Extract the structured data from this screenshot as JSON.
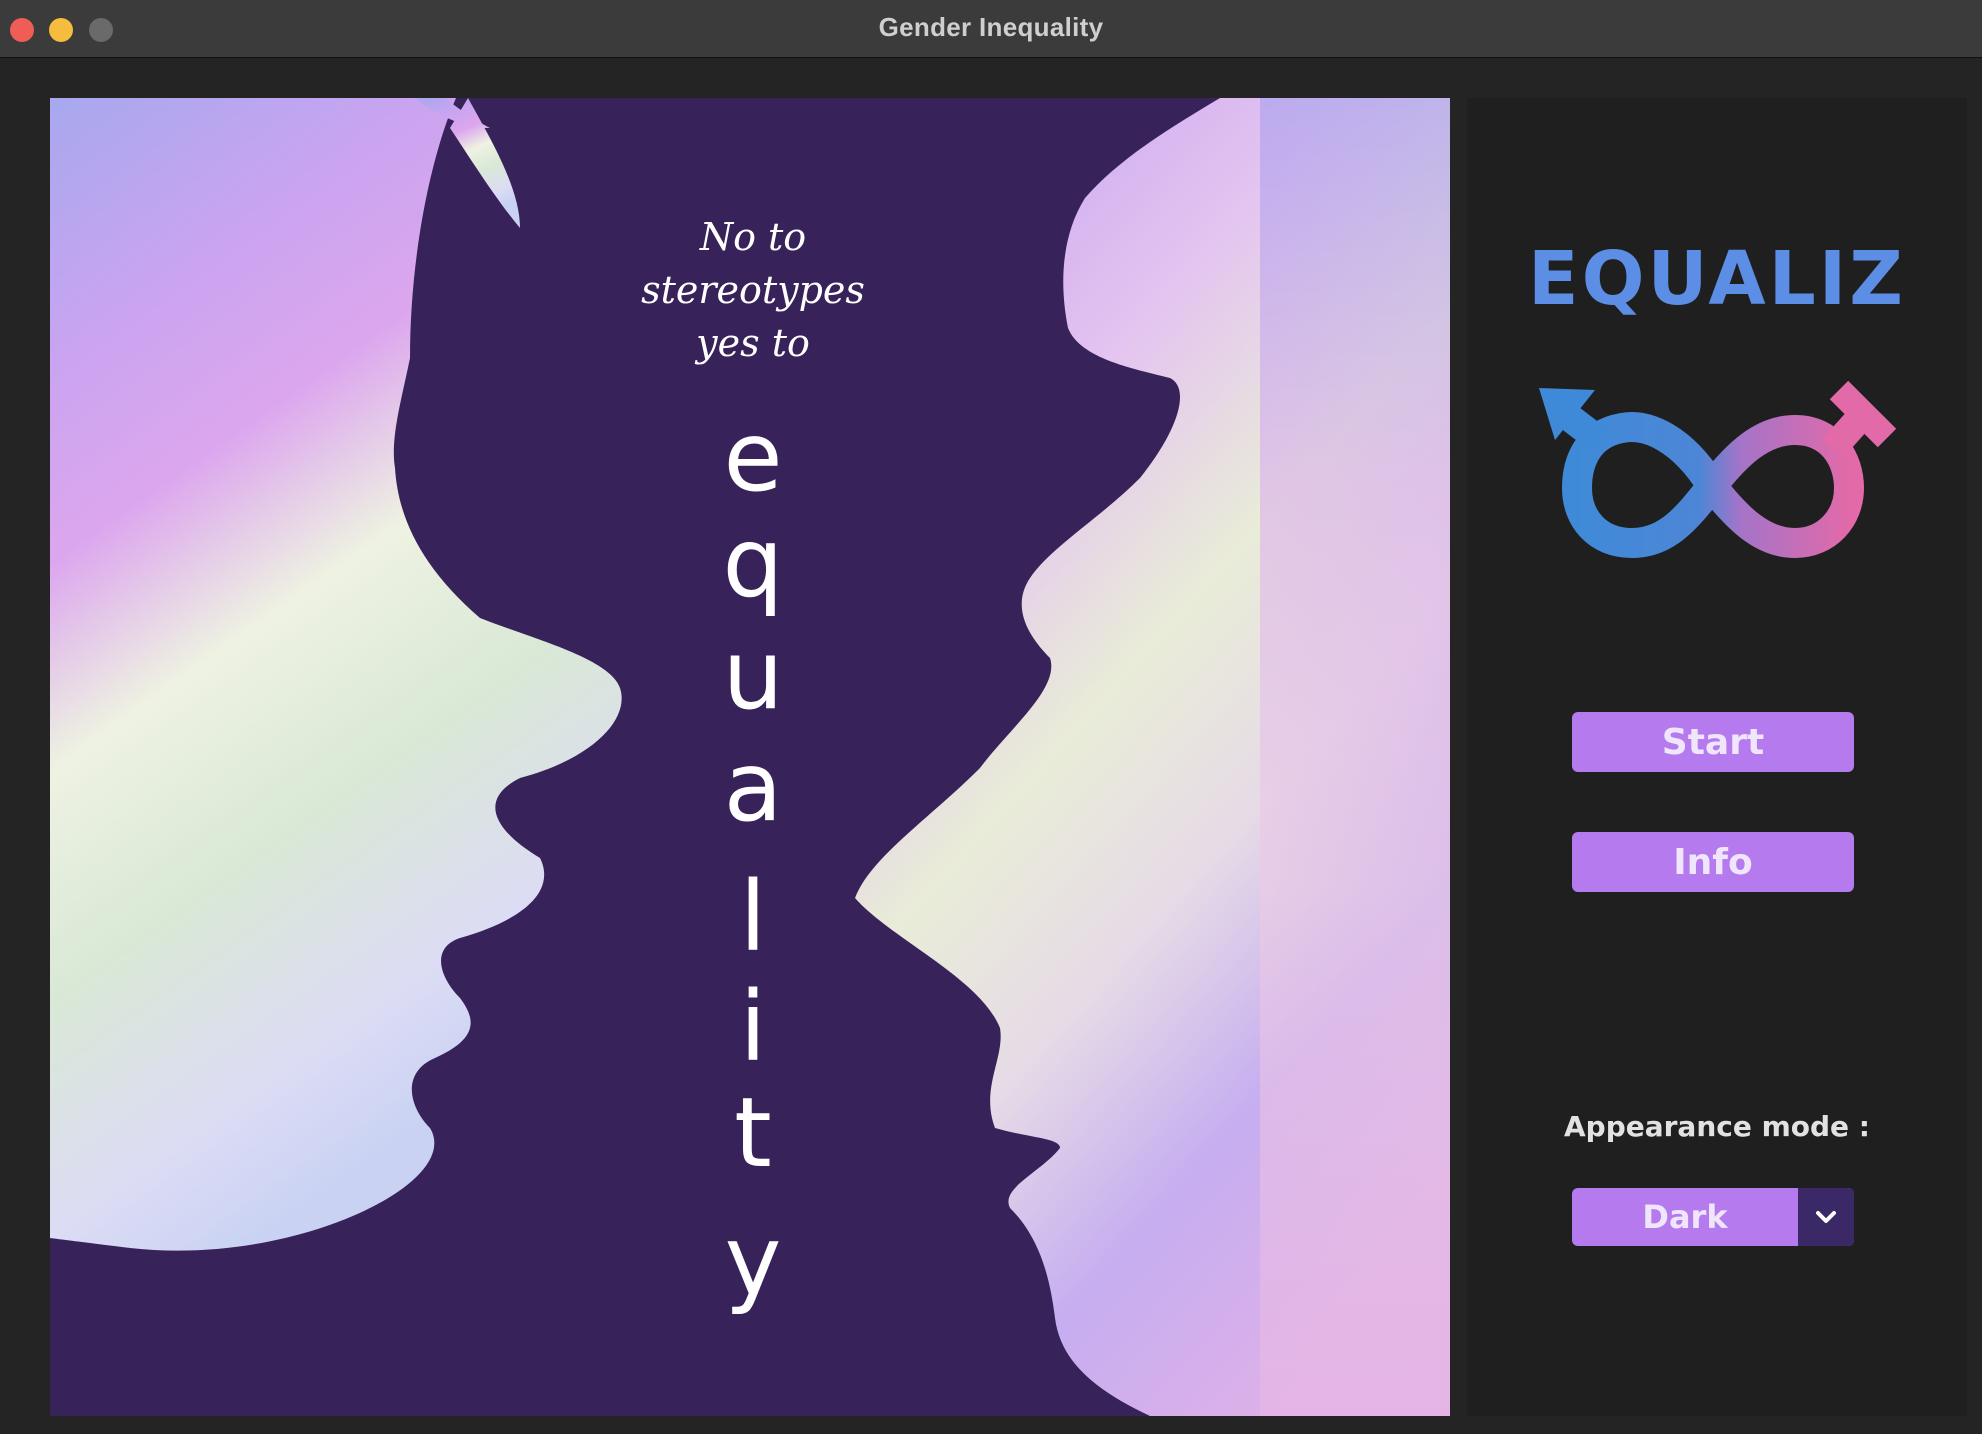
{
  "window": {
    "title": "Gender Inequality"
  },
  "poster": {
    "line1": "No to",
    "line2": "stereotypes",
    "line3": "yes to",
    "letters": [
      "e",
      "q",
      "u",
      "a",
      "l",
      "i",
      "t",
      "y"
    ],
    "colors": {
      "silhouette": "#372259",
      "lavender": "#c9a4f0",
      "mint": "#e3f0df",
      "pink": "#e6b4e8",
      "blue": "#a7a8ee"
    }
  },
  "sidebar": {
    "brand": "EQUALIZ",
    "logo_icon": "gender-equality-infinity-icon",
    "start_label": "Start",
    "info_label": "Info",
    "appearance_label": "Appearance mode :",
    "appearance_value": "Dark",
    "dropdown_icon": "chevron-down-icon"
  },
  "colors": {
    "accent": "#b57bee",
    "brand_blue": "#5c8ee6",
    "male_blue": "#3f8ad8",
    "female_pink": "#e26aa8",
    "dropdown_dark": "#3b2866",
    "background": "#242424"
  }
}
